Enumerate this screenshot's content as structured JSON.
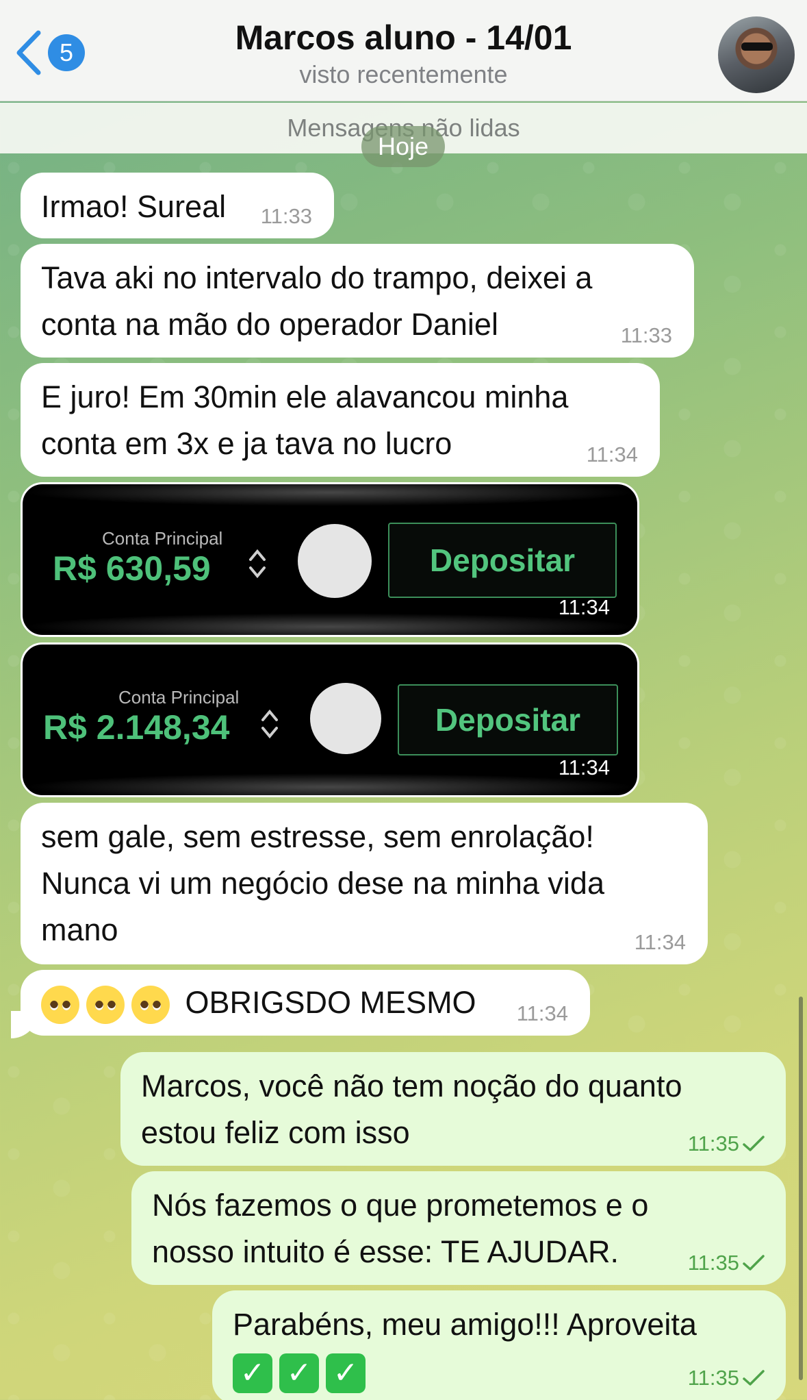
{
  "header": {
    "back_count": "5",
    "title": "Marcos aluno - 14/01",
    "status": "visto recentemente"
  },
  "unread_label": "Mensagens não lidas",
  "date_chip": "Hoje",
  "messages": [
    {
      "text": "Irmao! Sureal",
      "time": "11:33"
    },
    {
      "line1": "Tava aki no intervalo do trampo, deixei a",
      "line2": "conta na mão do operador Daniel",
      "time": "11:33"
    },
    {
      "line1": "E juro! Em 30min ele alavancou minha",
      "line2": "conta em 3x e ja tava no lucro",
      "time": "11:34"
    },
    {
      "account_label": "Conta Principal",
      "balance": "R$ 630,59",
      "deposit": "Depositar",
      "time": "11:34"
    },
    {
      "account_label": "Conta Principal",
      "balance": "R$ 2.148,34",
      "deposit": "Depositar",
      "time": "11:34"
    },
    {
      "line1": "sem gale, sem estresse, sem enrolação!",
      "line2": "Nunca vi um negócio dese na minha vida",
      "line3": "mano",
      "time": "11:34"
    },
    {
      "text": "OBRIGSDO MESMO",
      "emojis": [
        "pleading-face",
        "pleading-face",
        "pleading-face"
      ],
      "time": "11:34"
    }
  ],
  "outgoing": [
    {
      "line1": "Marcos, você não tem noção do quanto",
      "line2": "estou feliz com isso",
      "time": "11:35"
    },
    {
      "line1": "Nós fazemos o que prometemos e o",
      "line2": "nosso intuito é esse: TE AJUDAR.",
      "time": "11:35"
    },
    {
      "line1": "Parabéns, meu amigo!!! Aproveita",
      "emojis": [
        "check-mark-button",
        "check-mark-button",
        "check-mark-button"
      ],
      "time": "11:35"
    }
  ],
  "colors": {
    "accent": "#2f8de4",
    "outgoing_bubble": "#e6fbd9",
    "balance_green": "#4ec17a"
  }
}
